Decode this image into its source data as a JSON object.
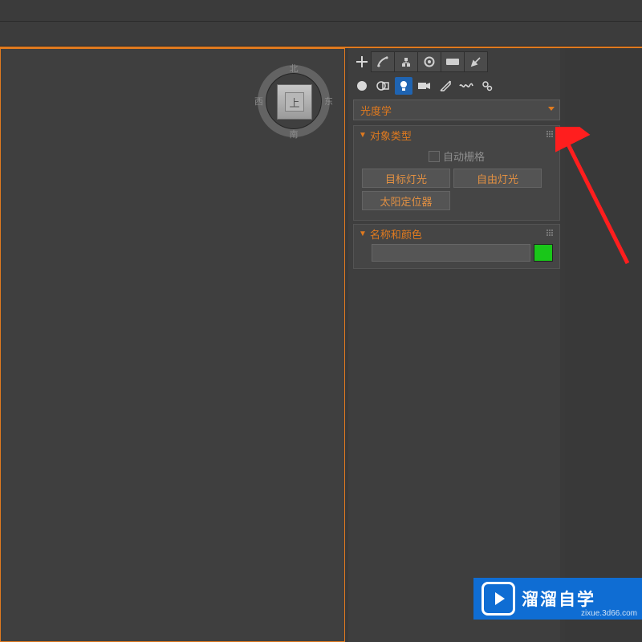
{
  "viewcube": {
    "top_label": "上",
    "north": "北",
    "south": "南",
    "east": "东",
    "west": "西"
  },
  "command_panel": {
    "main_tabs": {
      "create": "create",
      "modify": "modify",
      "hierarchy": "hierarchy",
      "motion": "motion",
      "display": "display",
      "utilities": "utilities"
    },
    "categories": {
      "geometry": "geometry",
      "shapes": "shapes",
      "lights": "lights",
      "cameras": "cameras",
      "helpers": "helpers",
      "spacewarps": "spacewarps",
      "systems": "systems"
    },
    "dropdown_label": "光度学",
    "rollouts": {
      "object_type": {
        "title": "对象类型",
        "auto_grid_label": "自动栅格",
        "buttons": {
          "target_light": "目标灯光",
          "free_light": "自由灯光",
          "sun_positioner": "太阳定位器"
        }
      },
      "name_color": {
        "title": "名称和颜色",
        "name_value": "",
        "color": "#19c619"
      }
    }
  },
  "watermark": {
    "brand": "溜溜自学",
    "url": "zixue.3d66.com"
  }
}
